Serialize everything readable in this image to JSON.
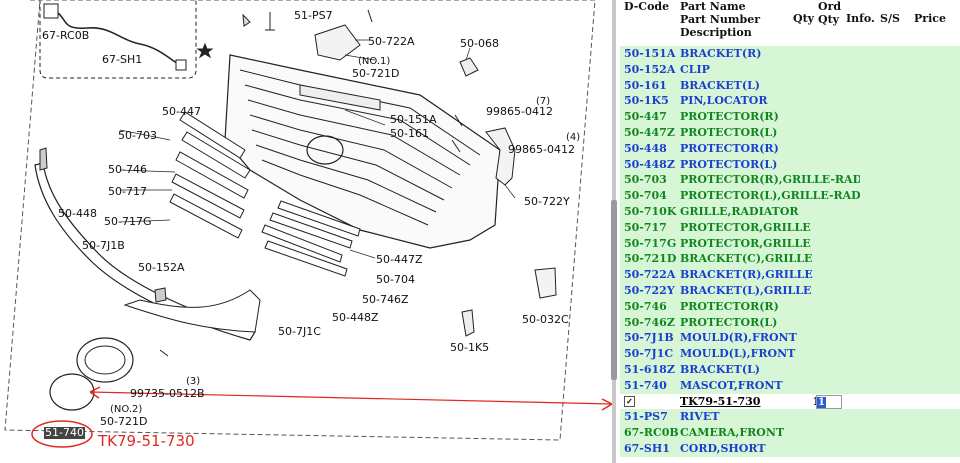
{
  "diagram": {
    "labels": [
      {
        "id": "67-RC0B",
        "text": "67-RC0B"
      },
      {
        "id": "67-SH1",
        "text": "67-SH1"
      },
      {
        "id": "51-PS7",
        "text": "51-PS7"
      },
      {
        "id": "50-722A",
        "text": "50-722A"
      },
      {
        "id": "50-068",
        "text": "50-068"
      },
      {
        "id": "no1",
        "text": "(NO.1)"
      },
      {
        "id": "50-721D-top",
        "text": "50-721D"
      },
      {
        "id": "50-447",
        "text": "50-447"
      },
      {
        "id": "qty7",
        "text": "(7)"
      },
      {
        "id": "99865-0412-a",
        "text": "99865-0412"
      },
      {
        "id": "50-151A",
        "text": "50-151A"
      },
      {
        "id": "50-161",
        "text": "50-161"
      },
      {
        "id": "50-703",
        "text": "50-703"
      },
      {
        "id": "qty4",
        "text": "(4)"
      },
      {
        "id": "99865-0412-b",
        "text": "99865-0412"
      },
      {
        "id": "50-746",
        "text": "50-746"
      },
      {
        "id": "50-717",
        "text": "50-717"
      },
      {
        "id": "50-722Y",
        "text": "50-722Y"
      },
      {
        "id": "50-448",
        "text": "50-448"
      },
      {
        "id": "50-717G",
        "text": "50-717G"
      },
      {
        "id": "50-7J1B",
        "text": "50-7J1B"
      },
      {
        "id": "50-447Z",
        "text": "50-447Z"
      },
      {
        "id": "50-152A",
        "text": "50-152A"
      },
      {
        "id": "50-704",
        "text": "50-704"
      },
      {
        "id": "50-746Z",
        "text": "50-746Z"
      },
      {
        "id": "50-448Z",
        "text": "50-448Z"
      },
      {
        "id": "50-032C",
        "text": "50-032C"
      },
      {
        "id": "50-7J1C",
        "text": "50-7J1C"
      },
      {
        "id": "50-1K5",
        "text": "50-1K5"
      },
      {
        "id": "qty3",
        "text": "(3)"
      },
      {
        "id": "99735-0512B",
        "text": "99735-0512B"
      },
      {
        "id": "no2",
        "text": "(NO.2)"
      },
      {
        "id": "50-721D-bottom",
        "text": "50-721D"
      }
    ],
    "highlighted_label": "51-740",
    "callout_text": "TK79-51-730"
  },
  "parts_table": {
    "headers": {
      "dcode": "D-Code",
      "name_line1": "Part Name",
      "name_line2": "Part Number",
      "name_line3": "Description",
      "qty": "Qty",
      "ord_line1": "Ord",
      "ord_line2": "Qty",
      "info": "Info.",
      "ss": "S/S",
      "price": "Price"
    },
    "rows": [
      {
        "code": "50-151A",
        "name": "BRACKET(R)",
        "color": "blue"
      },
      {
        "code": "50-152A",
        "name": "CLIP",
        "color": "blue"
      },
      {
        "code": "50-161",
        "name": "BRACKET(L)",
        "color": "blue"
      },
      {
        "code": "50-1K5",
        "name": "PIN,LOCATOR",
        "color": "blue"
      },
      {
        "code": "50-447",
        "name": "PROTECTOR(R)",
        "color": "green"
      },
      {
        "code": "50-447Z",
        "name": "PROTECTOR(L)",
        "color": "green"
      },
      {
        "code": "50-448",
        "name": "PROTECTOR(R)",
        "color": "blue"
      },
      {
        "code": "50-448Z",
        "name": "PROTECTOR(L)",
        "color": "blue"
      },
      {
        "code": "50-703",
        "name": "PROTECTOR(R),GRILLE-RAD.",
        "color": "green"
      },
      {
        "code": "50-704",
        "name": "PROTECTOR(L),GRILLE-RAD.",
        "color": "green"
      },
      {
        "code": "50-710K",
        "name": "GRILLE,RADIATOR",
        "color": "green"
      },
      {
        "code": "50-717",
        "name": "PROTECTOR,GRILLE",
        "color": "green"
      },
      {
        "code": "50-717G",
        "name": "PROTECTOR,GRILLE",
        "color": "green"
      },
      {
        "code": "50-721D",
        "name": "BRACKET(C),GRILLE",
        "color": "green"
      },
      {
        "code": "50-722A",
        "name": "BRACKET(R),GRILLE",
        "color": "blue"
      },
      {
        "code": "50-722Y",
        "name": "BRACKET(L),GRILLE",
        "color": "blue"
      },
      {
        "code": "50-746",
        "name": "PROTECTOR(R)",
        "color": "green"
      },
      {
        "code": "50-746Z",
        "name": "PROTECTOR(L)",
        "color": "green"
      },
      {
        "code": "50-7J1B",
        "name": "MOULD(R),FRONT",
        "color": "blue"
      },
      {
        "code": "50-7J1C",
        "name": "MOULD(L),FRONT",
        "color": "blue"
      },
      {
        "code": "51-618Z",
        "name": "BRACKET(L)",
        "color": "blue"
      },
      {
        "code": "51-740",
        "name": "MASCOT,FRONT",
        "color": "blue"
      }
    ],
    "selected_row": {
      "check": "✓",
      "part_number": "TK79-51-730",
      "qty": "1",
      "ord_qty": "1"
    },
    "rows_after": [
      {
        "code": "51-PS7",
        "name": "RIVET",
        "color": "blue"
      },
      {
        "code": "67-RC0B",
        "name": "CAMERA,FRONT",
        "color": "green"
      },
      {
        "code": "67-SH1",
        "name": "CORD,SHORT",
        "color": "blue"
      }
    ]
  },
  "colors": {
    "row_bg": "#d6f6d6",
    "blue_text": "#1a3fd0",
    "green_text": "#11861e",
    "annotation_red": "#e0281f"
  }
}
